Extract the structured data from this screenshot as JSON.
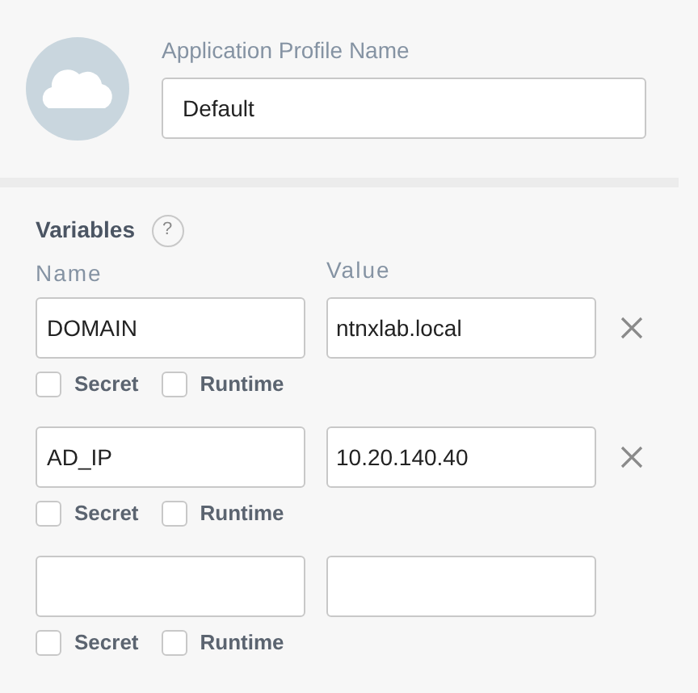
{
  "profile": {
    "label": "Application Profile Name",
    "value": "Default"
  },
  "variables": {
    "title": "Variables",
    "help": "?",
    "name_header": "Name",
    "value_header": "Value",
    "rows": [
      {
        "name": "DOMAIN",
        "value": "ntnxlab.local",
        "removable": true,
        "options": [
          {
            "label": "Secret",
            "checked": false
          },
          {
            "label": "Runtime",
            "checked": false
          }
        ]
      },
      {
        "name": "AD_IP",
        "value": "10.20.140.40",
        "removable": true,
        "options": [
          {
            "label": "Secret",
            "checked": false
          },
          {
            "label": "Runtime",
            "checked": false
          }
        ]
      },
      {
        "removable": false,
        "options": [
          {
            "label": "Secret",
            "checked": false
          },
          {
            "label": "Runtime",
            "checked": false
          }
        ]
      }
    ]
  }
}
